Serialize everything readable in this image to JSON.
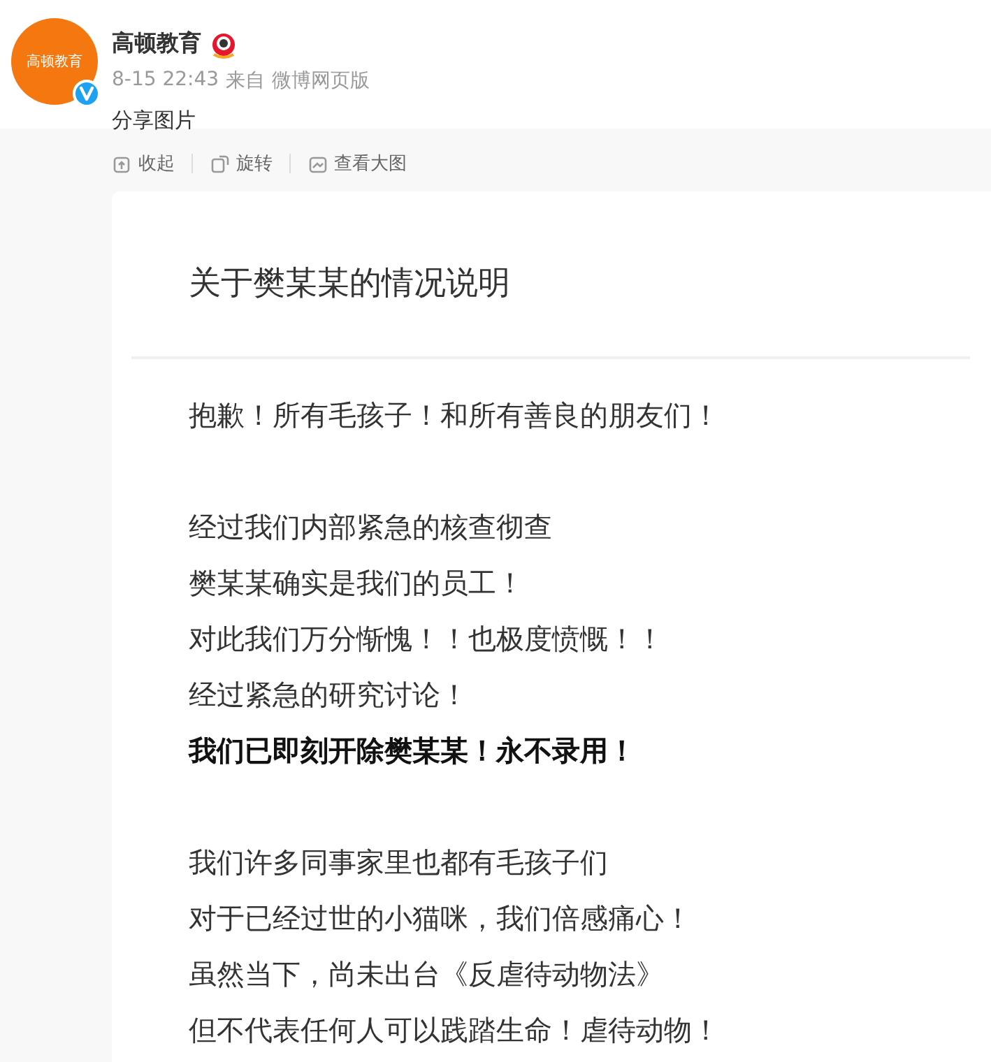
{
  "post": {
    "author": "高顿教育",
    "avatar_text": "高顿教育",
    "verified": true,
    "time": "8-15 22:43",
    "source_prefix": "来自",
    "source": "微博网页版",
    "text": "分享图片"
  },
  "image_toolbar": [
    {
      "kind": "collapse",
      "label": "收起"
    },
    {
      "kind": "rotate",
      "label": "旋转"
    },
    {
      "kind": "enlarge",
      "label": "查看大图"
    }
  ],
  "document": {
    "title": "关于樊某某的情况说明",
    "paragraphs": [
      {
        "lines": [
          {
            "text": "抱歉！所有毛孩子！和所有善良的朋友们！",
            "bold": false
          }
        ]
      },
      {
        "lines": [
          {
            "text": "经过我们内部紧急的核查彻查",
            "bold": false
          },
          {
            "text": "樊某某确实是我们的员工！",
            "bold": false
          },
          {
            "text": "对此我们万分惭愧！！也极度愤慨！！",
            "bold": false
          },
          {
            "text": "经过紧急的研究讨论！",
            "bold": false
          },
          {
            "text": "我们已即刻开除樊某某！永不录用！",
            "bold": true
          }
        ]
      },
      {
        "lines": [
          {
            "text": "我们许多同事家里也都有毛孩子们",
            "bold": false
          },
          {
            "text": "对于已经过世的小猫咪，我们倍感痛心！",
            "bold": false
          },
          {
            "text": "虽然当下，尚未出台《反虐待动物法》",
            "bold": false
          },
          {
            "text": "但不代表任何人可以践踏生命！虐待动物！",
            "bold": false
          }
        ]
      }
    ]
  }
}
